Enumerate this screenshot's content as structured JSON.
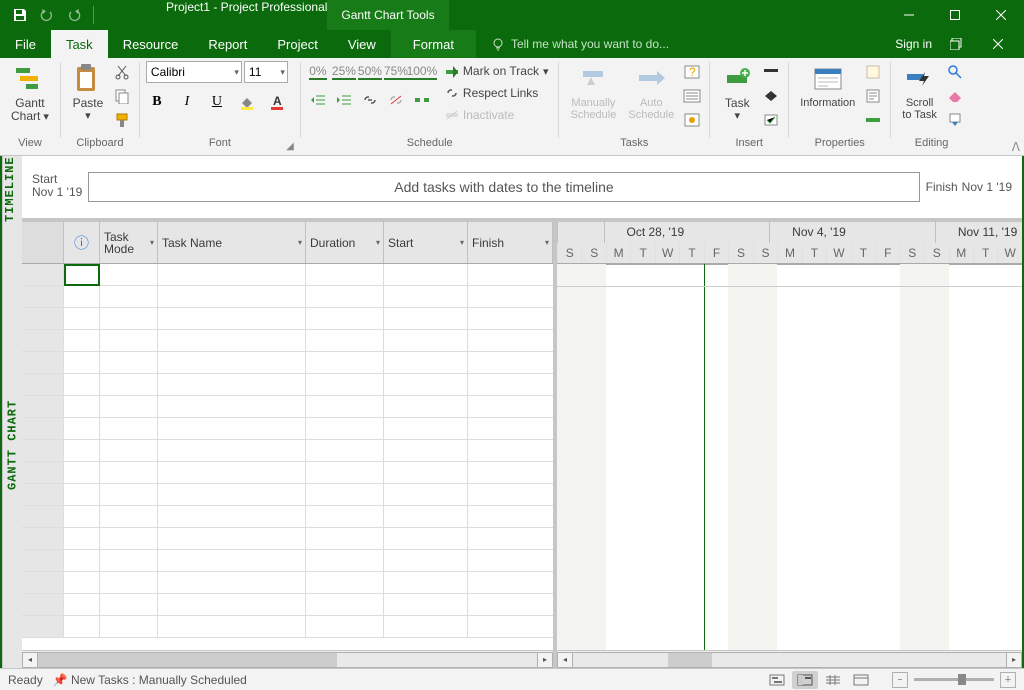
{
  "title": "Project1 - Project Professional",
  "toolTabsGroup": "Gantt Chart Tools",
  "tabs": {
    "file": "File",
    "task": "Task",
    "resource": "Resource",
    "report": "Report",
    "project": "Project",
    "view": "View",
    "format": "Format"
  },
  "tellme": "Tell me what you want to do...",
  "signin": "Sign in",
  "groups": {
    "view": "View",
    "clipboard": "Clipboard",
    "font": "Font",
    "schedule": "Schedule",
    "tasks": "Tasks",
    "insert": "Insert",
    "properties": "Properties",
    "editing": "Editing"
  },
  "btn": {
    "gantt": "Gantt\nChart",
    "paste": "Paste",
    "manual": "Manually\nSchedule",
    "auto": "Auto\nSchedule",
    "task": "Task",
    "info": "Information",
    "scroll": "Scroll\nto Task",
    "markontrack": "Mark on Track",
    "respect": "Respect Links",
    "inactivate": "Inactivate"
  },
  "font": {
    "family": "Calibri",
    "size": "11"
  },
  "pct": {
    "p0": "0%",
    "p25": "25%",
    "p50": "50%",
    "p75": "75%",
    "p100": "100%"
  },
  "timeline": {
    "labelV": "TIMELINE",
    "start": "Start",
    "startDate": "Nov 1 '19",
    "finish": "Finish",
    "finishDate": "Nov 1 '19",
    "prompt": "Add tasks with dates to the timeline"
  },
  "gantt": {
    "labelV": "GANTT CHART"
  },
  "cols": {
    "info": "ⓘ",
    "mode": "Task\nMode",
    "name": "Task Name",
    "duration": "Duration",
    "start": "Start",
    "finish": "Finish"
  },
  "weeks": {
    "w1": "Oct 28, '19",
    "w2": "Nov 4, '19",
    "w3": "Nov 11, '19"
  },
  "days": {
    "s": "S",
    "m": "M",
    "t": "T",
    "w": "W",
    "f": "F"
  },
  "status": {
    "ready": "Ready",
    "newtasks": "New Tasks : Manually Scheduled"
  }
}
